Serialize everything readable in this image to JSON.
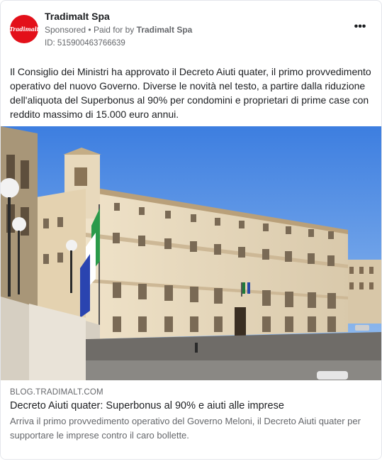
{
  "post": {
    "page_name": "Tradimalt Spa",
    "avatar_text": "Tradimalt",
    "sponsored": "Sponsored",
    "paid_for_by": "Paid for by",
    "payer": "Tradimalt Spa",
    "ad_id": "ID: 515900463766639",
    "more_icon": "more-horizontal-icon",
    "body": "Il Consiglio dei Ministri ha approvato il Decreto Aiuti quater, il primo provvedimento operativo del nuovo Governo. Diverse le novità nel testo, a partire dalla riduzione dell'aliquota del Superbonus al 90% per condomini e proprietari di prime case con reddito massimo di 15.000 euro annui."
  },
  "link": {
    "domain": "BLOG.TRADIMALT.COM",
    "headline": "Decreto Aiuti quater: Superbonus al 90% e aiuti alle imprese",
    "description": "Arriva il primo provvedimento operativo del Governo Meloni, il Decreto Aiuti quater per supportare le imprese contro il caro bollette."
  },
  "colors": {
    "brand": "#e3101a",
    "secondary_text": "#65676b",
    "primary_text": "#1c1e21"
  }
}
